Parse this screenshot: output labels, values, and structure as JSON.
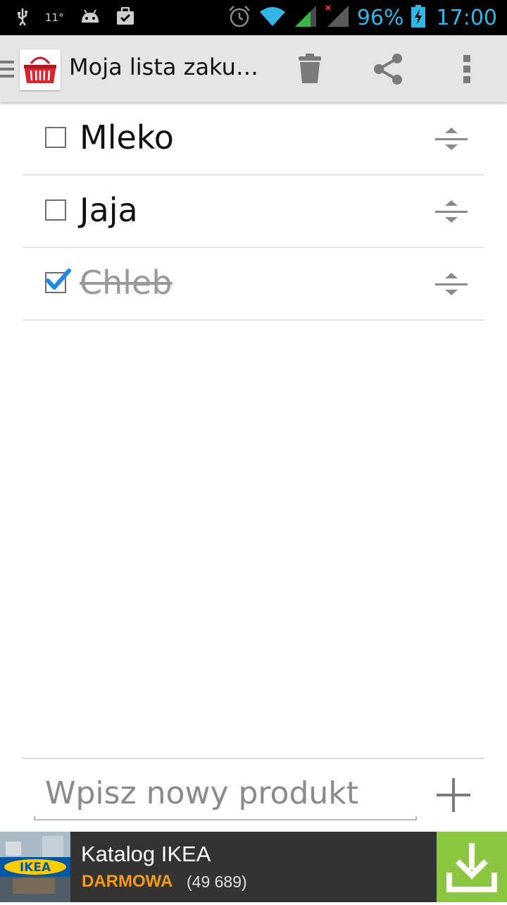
{
  "status_bar": {
    "temperature": "11°",
    "battery_percent": "96%",
    "time": "17:00"
  },
  "action_bar": {
    "title": "Moja lista zaku…",
    "icons": [
      "menu-icon",
      "basket-icon",
      "trash-icon",
      "share-icon",
      "overflow-icon"
    ]
  },
  "items": [
    {
      "label": "Mleko",
      "checked": false
    },
    {
      "label": "Jaja",
      "checked": false
    },
    {
      "label": "Chleb",
      "checked": true
    }
  ],
  "new_item": {
    "placeholder": "Wpisz nowy produkt",
    "value": ""
  },
  "ad": {
    "title": "Katalog IKEA",
    "price": "DARMOWA",
    "count": "(49 689)",
    "brand": "IKEA"
  },
  "colors": {
    "accent": "#33b5e5",
    "ad_price": "#f39a1a",
    "ad_download": "#8cc63f",
    "check_blue": "#1e88e5"
  }
}
